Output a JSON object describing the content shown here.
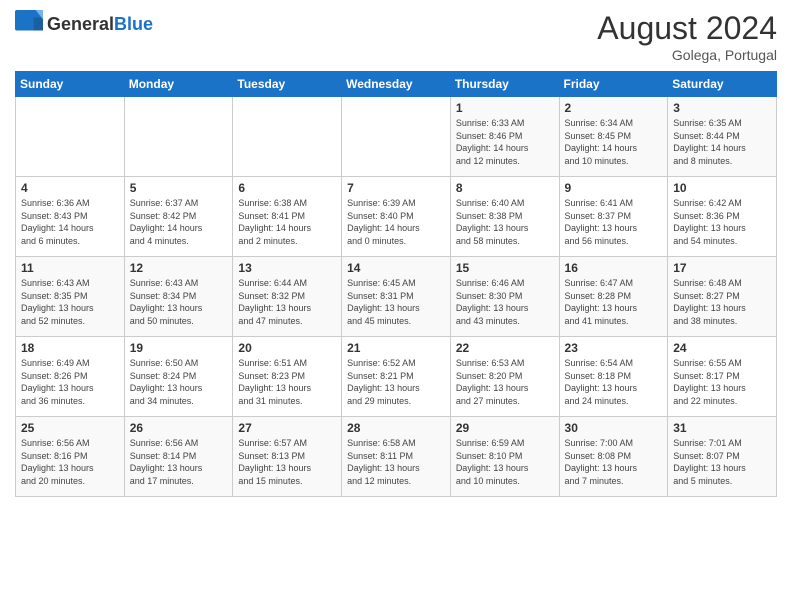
{
  "header": {
    "logo_general": "General",
    "logo_blue": "Blue",
    "month_year": "August 2024",
    "location": "Golega, Portugal"
  },
  "days_of_week": [
    "Sunday",
    "Monday",
    "Tuesday",
    "Wednesday",
    "Thursday",
    "Friday",
    "Saturday"
  ],
  "weeks": [
    [
      {
        "day": "",
        "info": ""
      },
      {
        "day": "",
        "info": ""
      },
      {
        "day": "",
        "info": ""
      },
      {
        "day": "",
        "info": ""
      },
      {
        "day": "1",
        "info": "Sunrise: 6:33 AM\nSunset: 8:46 PM\nDaylight: 14 hours\nand 12 minutes."
      },
      {
        "day": "2",
        "info": "Sunrise: 6:34 AM\nSunset: 8:45 PM\nDaylight: 14 hours\nand 10 minutes."
      },
      {
        "day": "3",
        "info": "Sunrise: 6:35 AM\nSunset: 8:44 PM\nDaylight: 14 hours\nand 8 minutes."
      }
    ],
    [
      {
        "day": "4",
        "info": "Sunrise: 6:36 AM\nSunset: 8:43 PM\nDaylight: 14 hours\nand 6 minutes."
      },
      {
        "day": "5",
        "info": "Sunrise: 6:37 AM\nSunset: 8:42 PM\nDaylight: 14 hours\nand 4 minutes."
      },
      {
        "day": "6",
        "info": "Sunrise: 6:38 AM\nSunset: 8:41 PM\nDaylight: 14 hours\nand 2 minutes."
      },
      {
        "day": "7",
        "info": "Sunrise: 6:39 AM\nSunset: 8:40 PM\nDaylight: 14 hours\nand 0 minutes."
      },
      {
        "day": "8",
        "info": "Sunrise: 6:40 AM\nSunset: 8:38 PM\nDaylight: 13 hours\nand 58 minutes."
      },
      {
        "day": "9",
        "info": "Sunrise: 6:41 AM\nSunset: 8:37 PM\nDaylight: 13 hours\nand 56 minutes."
      },
      {
        "day": "10",
        "info": "Sunrise: 6:42 AM\nSunset: 8:36 PM\nDaylight: 13 hours\nand 54 minutes."
      }
    ],
    [
      {
        "day": "11",
        "info": "Sunrise: 6:43 AM\nSunset: 8:35 PM\nDaylight: 13 hours\nand 52 minutes."
      },
      {
        "day": "12",
        "info": "Sunrise: 6:43 AM\nSunset: 8:34 PM\nDaylight: 13 hours\nand 50 minutes."
      },
      {
        "day": "13",
        "info": "Sunrise: 6:44 AM\nSunset: 8:32 PM\nDaylight: 13 hours\nand 47 minutes."
      },
      {
        "day": "14",
        "info": "Sunrise: 6:45 AM\nSunset: 8:31 PM\nDaylight: 13 hours\nand 45 minutes."
      },
      {
        "day": "15",
        "info": "Sunrise: 6:46 AM\nSunset: 8:30 PM\nDaylight: 13 hours\nand 43 minutes."
      },
      {
        "day": "16",
        "info": "Sunrise: 6:47 AM\nSunset: 8:28 PM\nDaylight: 13 hours\nand 41 minutes."
      },
      {
        "day": "17",
        "info": "Sunrise: 6:48 AM\nSunset: 8:27 PM\nDaylight: 13 hours\nand 38 minutes."
      }
    ],
    [
      {
        "day": "18",
        "info": "Sunrise: 6:49 AM\nSunset: 8:26 PM\nDaylight: 13 hours\nand 36 minutes."
      },
      {
        "day": "19",
        "info": "Sunrise: 6:50 AM\nSunset: 8:24 PM\nDaylight: 13 hours\nand 34 minutes."
      },
      {
        "day": "20",
        "info": "Sunrise: 6:51 AM\nSunset: 8:23 PM\nDaylight: 13 hours\nand 31 minutes."
      },
      {
        "day": "21",
        "info": "Sunrise: 6:52 AM\nSunset: 8:21 PM\nDaylight: 13 hours\nand 29 minutes."
      },
      {
        "day": "22",
        "info": "Sunrise: 6:53 AM\nSunset: 8:20 PM\nDaylight: 13 hours\nand 27 minutes."
      },
      {
        "day": "23",
        "info": "Sunrise: 6:54 AM\nSunset: 8:18 PM\nDaylight: 13 hours\nand 24 minutes."
      },
      {
        "day": "24",
        "info": "Sunrise: 6:55 AM\nSunset: 8:17 PM\nDaylight: 13 hours\nand 22 minutes."
      }
    ],
    [
      {
        "day": "25",
        "info": "Sunrise: 6:56 AM\nSunset: 8:16 PM\nDaylight: 13 hours\nand 20 minutes."
      },
      {
        "day": "26",
        "info": "Sunrise: 6:56 AM\nSunset: 8:14 PM\nDaylight: 13 hours\nand 17 minutes."
      },
      {
        "day": "27",
        "info": "Sunrise: 6:57 AM\nSunset: 8:13 PM\nDaylight: 13 hours\nand 15 minutes."
      },
      {
        "day": "28",
        "info": "Sunrise: 6:58 AM\nSunset: 8:11 PM\nDaylight: 13 hours\nand 12 minutes."
      },
      {
        "day": "29",
        "info": "Sunrise: 6:59 AM\nSunset: 8:10 PM\nDaylight: 13 hours\nand 10 minutes."
      },
      {
        "day": "30",
        "info": "Sunrise: 7:00 AM\nSunset: 8:08 PM\nDaylight: 13 hours\nand 7 minutes."
      },
      {
        "day": "31",
        "info": "Sunrise: 7:01 AM\nSunset: 8:07 PM\nDaylight: 13 hours\nand 5 minutes."
      }
    ]
  ]
}
